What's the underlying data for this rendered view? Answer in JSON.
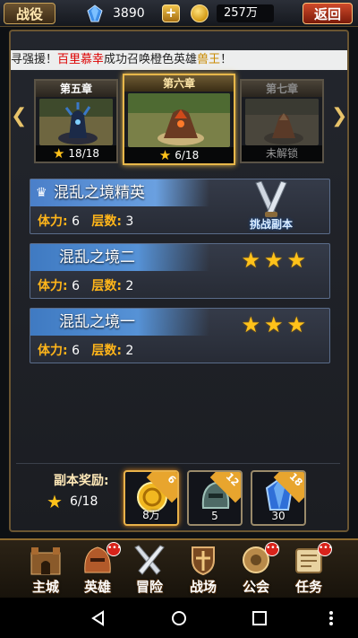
{
  "header": {
    "title": "战役",
    "gems": "3890",
    "plus_label": "+",
    "gold": "257万",
    "back_label": "返回"
  },
  "marquee": {
    "prefix": "寻强援！",
    "player": "百里慕幸",
    "middle": "成功召唤橙色英雄",
    "hero": "兽王",
    "suffix": "！"
  },
  "chapters": [
    {
      "title": "第五章",
      "progress": "18/18",
      "state": "cleared"
    },
    {
      "title": "第六章",
      "progress": "6/18",
      "state": "current"
    },
    {
      "title": "第七章",
      "progress": "未解锁",
      "state": "locked"
    }
  ],
  "dungeons": [
    {
      "name": "混乱之境精英",
      "stamina_label": "体力:",
      "stamina": "6",
      "floors_label": "层数:",
      "floors": "3",
      "elite": true,
      "action_label": "挑战副本",
      "stars": ""
    },
    {
      "name": "混乱之境二",
      "stamina_label": "体力:",
      "stamina": "6",
      "floors_label": "层数:",
      "floors": "2",
      "elite": false,
      "stars": "★★★"
    },
    {
      "name": "混乱之境一",
      "stamina_label": "体力:",
      "stamina": "6",
      "floors_label": "层数:",
      "floors": "2",
      "elite": false,
      "stars": "★★★"
    }
  ],
  "rewards": {
    "label": "副本奖励:",
    "progress": "6/18",
    "items": [
      {
        "icon": "gold-coin-icon",
        "threshold": "6",
        "quantity": "8万"
      },
      {
        "icon": "hero-helmet-icon",
        "threshold": "12",
        "quantity": "5"
      },
      {
        "icon": "blue-gem-icon",
        "threshold": "18",
        "quantity": "30"
      }
    ]
  },
  "nav": [
    {
      "label": "主城",
      "icon": "castle-icon",
      "dot": false
    },
    {
      "label": "英雄",
      "icon": "helmet-icon",
      "dot": true
    },
    {
      "label": "冒险",
      "icon": "swords-icon",
      "dot": false
    },
    {
      "label": "战场",
      "icon": "shield-icon",
      "dot": false
    },
    {
      "label": "公会",
      "icon": "guild-icon",
      "dot": true
    },
    {
      "label": "任务",
      "icon": "scroll-icon",
      "dot": true
    }
  ],
  "colors": {
    "accent_gold": "#e7b74a",
    "banner_blue": "#4f89cf",
    "stat_label": "#ffb51a",
    "alert_red": "#d8231b"
  }
}
